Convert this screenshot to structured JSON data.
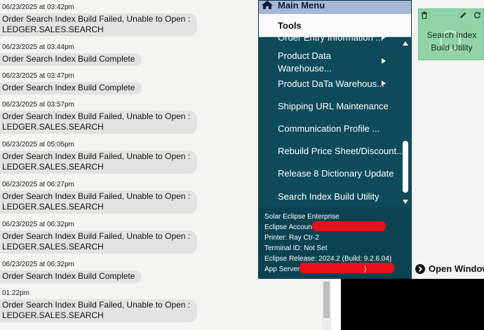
{
  "log": {
    "entries": [
      {
        "timestamp": "06/23/2025 at 03:42pm",
        "lines": [
          "Order Search Index Build Failed, Unable to Open :",
          "LEDGER.SALES.SEARCH"
        ]
      },
      {
        "timestamp": "06/23/2025 at 03:44pm",
        "lines": [
          "Order Search Index Build Complete"
        ]
      },
      {
        "timestamp": "06/23/2025 at 03:47pm",
        "lines": [
          "Order Search Index Build Complete"
        ]
      },
      {
        "timestamp": "06/23/2025 at 03:57pm",
        "lines": [
          "Order Search Index Build Failed, Unable to Open :",
          "LEDGER.SALES.SEARCH"
        ]
      },
      {
        "timestamp": "06/23/2025 at 05:05pm",
        "lines": [
          "Order Search Index Build Failed, Unable to Open :",
          "LEDGER.SALES.SEARCH"
        ]
      },
      {
        "timestamp": "06/23/2025 at 06:27pm",
        "lines": [
          "Order Search Index Build Failed, Unable to Open :",
          "LEDGER.SALES.SEARCH"
        ]
      },
      {
        "timestamp": "06/23/2025 at 06:32pm",
        "lines": [
          "Order Search Index Build Failed, Unable to Open :",
          "LEDGER.SALES.SEARCH"
        ]
      },
      {
        "timestamp": "06/23/2025 at 06:32pm",
        "lines": [
          "Order Search Index Build Complete"
        ]
      },
      {
        "timestamp": "01:22pm",
        "lines": [
          "Order Search Index Build Failed, Unable to Open :",
          "LEDGER.SALES.SEARCH"
        ]
      }
    ]
  },
  "menu": {
    "title": "Main Menu",
    "section": "Tools",
    "items": [
      {
        "label": "Order Entry Information ...",
        "submenu": true
      },
      {
        "label": "Product Data",
        "label2": "Warehouse...",
        "submenu": true
      },
      {
        "label": "Product DaTa Warehous...",
        "submenu": true
      },
      {
        "label": "Shipping URL Maintenance",
        "submenu": false
      },
      {
        "label": "Communication Profile ...",
        "submenu": false
      },
      {
        "label": "Rebuild Price Sheet/Discount...",
        "submenu": false
      },
      {
        "label": "Release 8 Dictionary Update",
        "submenu": false
      },
      {
        "label": "Search Index Build Utility",
        "submenu": false
      }
    ],
    "info": {
      "product": "Solar Eclipse Enterprise",
      "account": "Eclipse Account",
      "printer": "Printer: Ray Ctr-2",
      "terminal": "Terminal ID: Not Set",
      "release": "Eclipse Release: 2024.2 (Build: 9.2.6.04)",
      "app_server": "App Server",
      "app_server_tail": ")"
    }
  },
  "tile": {
    "title_line1": "Search Index",
    "title_line2": "Build Utility"
  },
  "open_windows": {
    "label": "Open Window"
  },
  "colors": {
    "menu_bg": "#0f4b5b",
    "menu_header": "#a7b6d6",
    "tile_bg": "#8fd3a7",
    "bubble_bg": "#e2e2e2",
    "redaction": "#e8101b"
  }
}
